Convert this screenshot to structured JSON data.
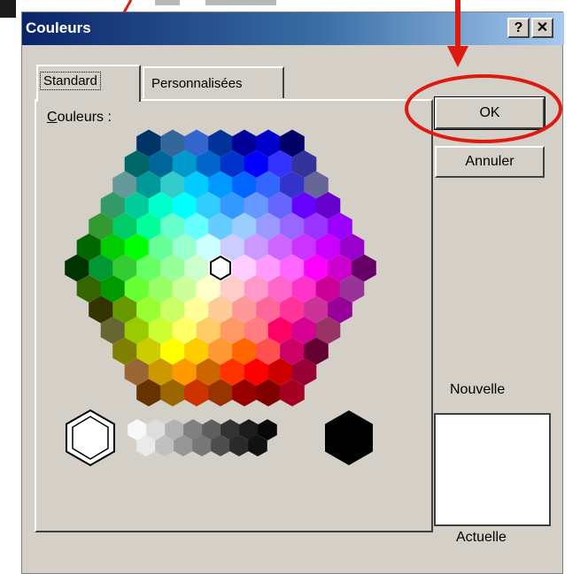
{
  "window": {
    "title": "Couleurs"
  },
  "title_buttons": {
    "help": "?",
    "close": "✕"
  },
  "tabs": {
    "standard": "Standard",
    "custom": "Personnalisées"
  },
  "colors_label": {
    "accel": "C",
    "rest": "ouleurs :"
  },
  "buttons": {
    "ok": "OK",
    "cancel": "Annuler"
  },
  "preview": {
    "new_label": "Nouvelle",
    "current_label": "Actuelle"
  },
  "palette": {
    "rows": [
      [
        "#003366",
        "#336699",
        "#3366cc",
        "#003399",
        "#000099",
        "#0000cc",
        "#000066"
      ],
      [
        "#006666",
        "#006699",
        "#0099cc",
        "#0066cc",
        "#0033cc",
        "#0000ff",
        "#3333ff",
        "#333399"
      ],
      [
        "#669999",
        "#009999",
        "#33cccc",
        "#00ccff",
        "#0099ff",
        "#0066ff",
        "#3366ff",
        "#3333cc",
        "#666699"
      ],
      [
        "#339966",
        "#00cc99",
        "#00ffcc",
        "#00ffff",
        "#33ccff",
        "#3399ff",
        "#6699ff",
        "#6666ff",
        "#6600ff",
        "#6600cc"
      ],
      [
        "#339933",
        "#00cc66",
        "#00ff99",
        "#66ffcc",
        "#66ffff",
        "#66ccff",
        "#99ccff",
        "#9999ff",
        "#9966ff",
        "#9933ff",
        "#9900ff"
      ],
      [
        "#006600",
        "#00cc00",
        "#00ff00",
        "#66ff99",
        "#99ffcc",
        "#ccffff",
        "#ccccff",
        "#cc99ff",
        "#cc66ff",
        "#cc33ff",
        "#cc00ff",
        "#9900cc"
      ],
      [
        "#003300",
        "#009933",
        "#33cc33",
        "#66ff66",
        "#99ff99",
        "#ccffcc",
        "#ffffff",
        "#ffccff",
        "#ff99ff",
        "#ff66ff",
        "#ff00ff",
        "#cc00cc",
        "#660066"
      ],
      [
        "#336600",
        "#009900",
        "#66ff33",
        "#99ff66",
        "#ccff99",
        "#ffffcc",
        "#ffcccc",
        "#ff99cc",
        "#ff66cc",
        "#ff33cc",
        "#cc0099",
        "#993399"
      ],
      [
        "#333300",
        "#669900",
        "#99ff33",
        "#ccff66",
        "#ffff99",
        "#ffcc99",
        "#ff9999",
        "#ff6699",
        "#ff3399",
        "#cc3399",
        "#990099"
      ],
      [
        "#666633",
        "#99cc00",
        "#ccff33",
        "#ffff66",
        "#ffcc66",
        "#ff9966",
        "#ff7c80",
        "#ff0066",
        "#d60093",
        "#993366"
      ],
      [
        "#808000",
        "#cccc00",
        "#ffff00",
        "#ffcc00",
        "#ff9933",
        "#ff6600",
        "#ff5050",
        "#cc0066",
        "#660033"
      ],
      [
        "#996633",
        "#cc9900",
        "#ff9900",
        "#cc6600",
        "#ff3300",
        "#ff0000",
        "#cc0000",
        "#990033"
      ],
      [
        "#663300",
        "#996600",
        "#cc3300",
        "#993300",
        "#990000",
        "#800000",
        "#a50021"
      ]
    ],
    "grays": [
      "#f8f8f8",
      "#dddddd",
      "#b2b2b2",
      "#808080",
      "#5f5f5f",
      "#333333",
      "#1c1c1c",
      "#080808",
      "#eaeaea",
      "#c0c0c0",
      "#969696",
      "#777777",
      "#4d4d4d",
      "#292929",
      "#111111"
    ],
    "white": "#ffffff",
    "black": "#000000"
  }
}
